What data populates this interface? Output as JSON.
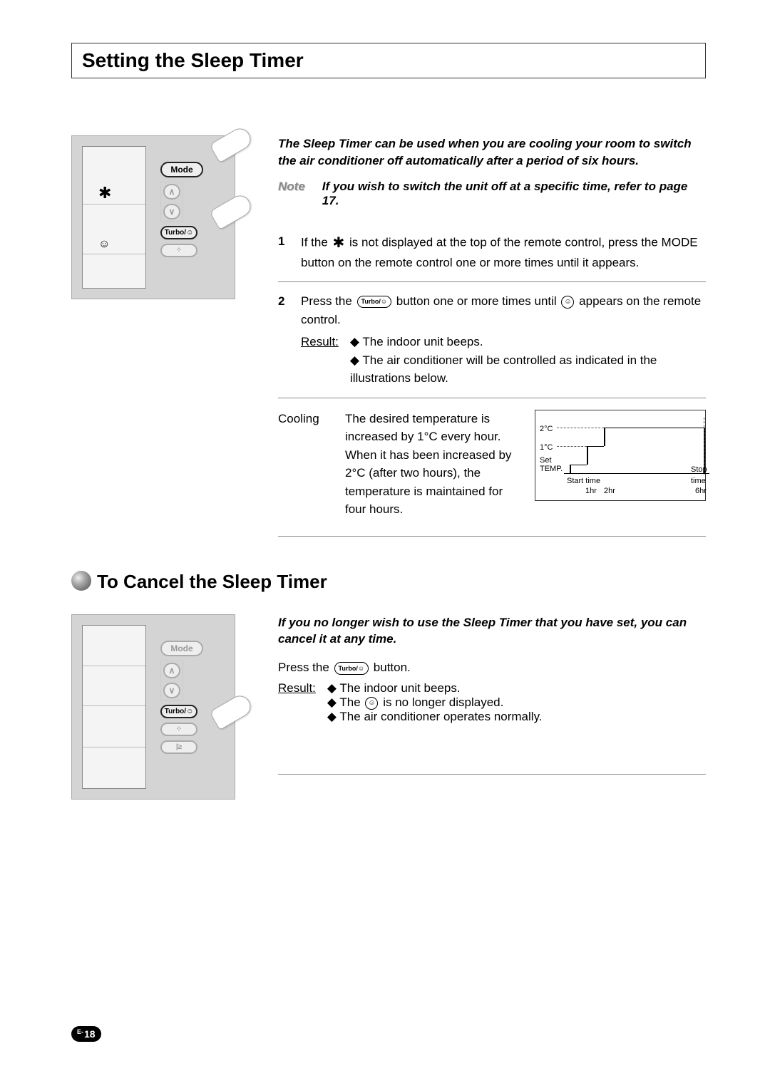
{
  "page": {
    "title": "Setting the Sleep Timer",
    "subtitle": "To Cancel the Sleep Timer",
    "page_num_prefix": "E-",
    "page_num": "18"
  },
  "remote": {
    "mode_label": "Mode",
    "turbo_label": "Turbo/",
    "snow_glyph": "✱",
    "moon_glyph": "☺",
    "up_glyph": "∧",
    "down_glyph": "∨"
  },
  "section1": {
    "intro": "The Sleep Timer can be used when you are cooling your room to switch the air conditioner off automatically after a period of six hours.",
    "note_label": "Note",
    "note_text": "If you wish to switch the unit off at a specific time, refer to page 17.",
    "step1_num": "1",
    "step1_a": "If the ",
    "step1_b": " is not displayed at the top of the remote control, press the MODE button on the remote control one or more times until it appears.",
    "step2_num": "2",
    "step2_a": "Press the ",
    "step2_b": "button one or more times until ",
    "step2_c": "appears on the remote control.",
    "result_label": "Result:",
    "result_items": [
      "The indoor unit beeps.",
      "The air conditioner will be controlled as indicated in the illustrations below."
    ],
    "cooling_label": "Cooling",
    "cooling_text": "The desired temperature is increased by 1°C every hour. When it has been increased by 2°C (after two hours), the temperature is maintained for four hours.",
    "turbo_pill": "Turbo/☺",
    "moon_inline": "☺",
    "snow_inline": "✱"
  },
  "chart_data": {
    "type": "line",
    "title": "",
    "xlabel": "",
    "ylabel": "",
    "y_ticks": [
      "2°C",
      "1°C",
      "Set TEMP."
    ],
    "x_ticks": [
      "Start time",
      "1hr",
      "2hr",
      "6hr",
      "Stop time"
    ],
    "x": [
      0,
      1,
      2,
      6
    ],
    "values": [
      0,
      1,
      2,
      2
    ],
    "ylim": [
      0,
      2
    ],
    "xlim": [
      0,
      6
    ]
  },
  "section2": {
    "intro": "If you no longer wish to use the Sleep Timer that you have set, you can cancel it at any time.",
    "press_a": "Press the ",
    "press_b": "button.",
    "result_label": "Result:",
    "result_items": [
      "The indoor unit beeps.",
      "The      is no longer displayed.",
      "The air conditioner operates normally."
    ],
    "turbo_pill": "Turbo/☺",
    "moon_inline": "☺",
    "r2_b_pre": "The ",
    "r2_b_post": " is no longer displayed."
  }
}
